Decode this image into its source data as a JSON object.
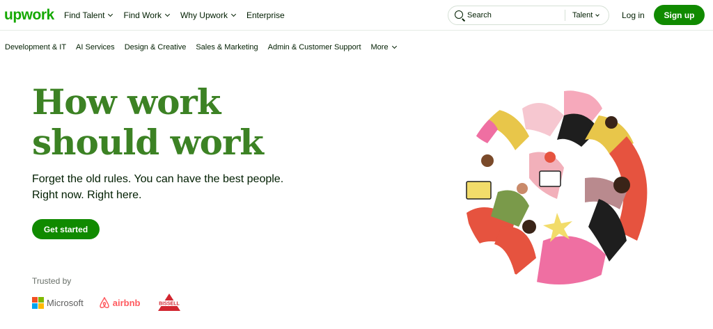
{
  "brand": {
    "logo_text": "upwork",
    "primary": "#14a800",
    "button": "#108a00",
    "headline": "#3c8224"
  },
  "nav": {
    "items": [
      {
        "label": "Find Talent",
        "dropdown": true
      },
      {
        "label": "Find Work",
        "dropdown": true
      },
      {
        "label": "Why Upwork",
        "dropdown": true
      },
      {
        "label": "Enterprise",
        "dropdown": false
      }
    ],
    "search_placeholder": "Search",
    "search_scope": "Talent",
    "login_label": "Log in",
    "signup_label": "Sign up"
  },
  "categories": {
    "items": [
      "Development & IT",
      "AI Services",
      "Design & Creative",
      "Sales & Marketing",
      "Admin & Customer Support"
    ],
    "more_label": "More"
  },
  "hero": {
    "title": "How work\nshould work",
    "subtitle": "Forget the old rules. You can have the best people.\nRight now. Right here.",
    "cta_label": "Get started"
  },
  "trusted": {
    "label": "Trusted by",
    "logos": [
      "Microsoft",
      "airbnb",
      "BISSELL"
    ]
  },
  "icons": [
    "search-icon",
    "chevron-down-icon",
    "microsoft-logo",
    "airbnb-logo",
    "bissell-logo"
  ]
}
